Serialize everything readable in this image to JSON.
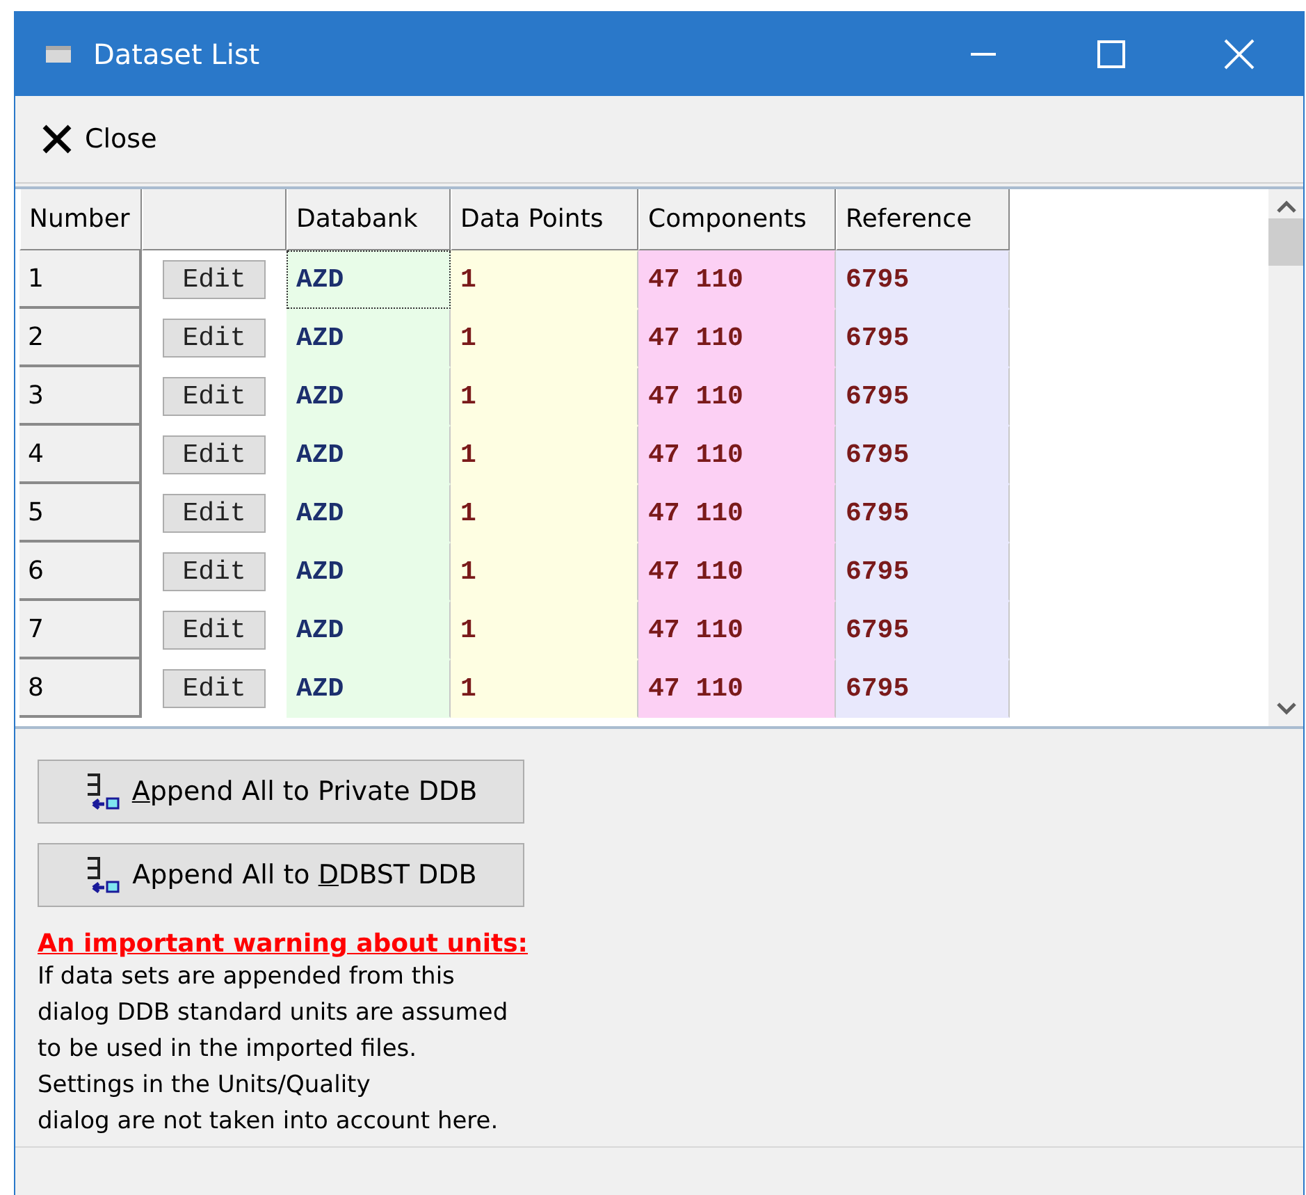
{
  "window": {
    "title": "Dataset List"
  },
  "toolbar": {
    "close_label": "Close"
  },
  "table": {
    "columns": [
      "Number",
      "",
      "Databank",
      "Data Points",
      "Components",
      "Reference"
    ],
    "rows": [
      {
        "number": "1",
        "edit": "Edit",
        "databank": "AZD",
        "data_points": "1",
        "components": "47 110",
        "reference": "6795",
        "focused": true
      },
      {
        "number": "2",
        "edit": "Edit",
        "databank": "AZD",
        "data_points": "1",
        "components": "47 110",
        "reference": "6795",
        "focused": false
      },
      {
        "number": "3",
        "edit": "Edit",
        "databank": "AZD",
        "data_points": "1",
        "components": "47 110",
        "reference": "6795",
        "focused": false
      },
      {
        "number": "4",
        "edit": "Edit",
        "databank": "AZD",
        "data_points": "1",
        "components": "47 110",
        "reference": "6795",
        "focused": false
      },
      {
        "number": "5",
        "edit": "Edit",
        "databank": "AZD",
        "data_points": "1",
        "components": "47 110",
        "reference": "6795",
        "focused": false
      },
      {
        "number": "6",
        "edit": "Edit",
        "databank": "AZD",
        "data_points": "1",
        "components": "47 110",
        "reference": "6795",
        "focused": false
      },
      {
        "number": "7",
        "edit": "Edit",
        "databank": "AZD",
        "data_points": "1",
        "components": "47 110",
        "reference": "6795",
        "focused": false
      },
      {
        "number": "8",
        "edit": "Edit",
        "databank": "AZD",
        "data_points": "1",
        "components": "47 110",
        "reference": "6795",
        "focused": false
      }
    ]
  },
  "buttons": [
    {
      "key": "A",
      "after": "ppend All to Private DDB"
    },
    {
      "before": "Append All to ",
      "key": "D",
      "after": "DBST DDB"
    }
  ],
  "warning": {
    "heading": "An important warning about units:",
    "lines": [
      "If data sets are appended from this",
      "dialog DDB standard units are assumed",
      "to be used in the imported files.",
      "Settings in the Units/Quality",
      "dialog are not taken into account here."
    ]
  }
}
